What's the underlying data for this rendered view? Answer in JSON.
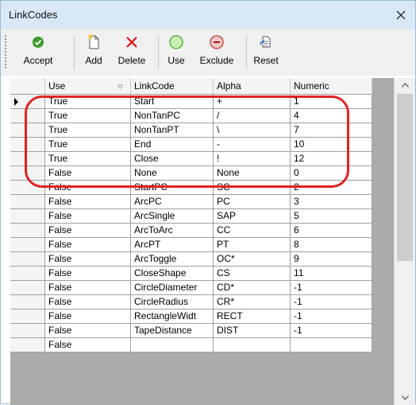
{
  "window": {
    "title": "LinkCodes"
  },
  "toolbar": {
    "buttons": [
      {
        "label": "Accept",
        "icon": "check-circle-icon"
      },
      {
        "label": "Add",
        "icon": "new-document-icon"
      },
      {
        "label": "Delete",
        "icon": "red-x-icon"
      },
      {
        "label": "Use",
        "icon": "green-circle-icon"
      },
      {
        "label": "Exclude",
        "icon": "minus-circle-icon"
      },
      {
        "label": "Reset",
        "icon": "reset-icon"
      }
    ]
  },
  "grid": {
    "columns": [
      "Use",
      "LinkCode",
      "Alpha",
      "Numeric"
    ],
    "current_row": 0,
    "rows": [
      [
        "True",
        "Start",
        "+",
        "1"
      ],
      [
        "True",
        "NonTanPC",
        "/",
        "4"
      ],
      [
        "True",
        "NonTanPT",
        "\\",
        "7"
      ],
      [
        "True",
        "End",
        "-",
        "10"
      ],
      [
        "True",
        "Close",
        "!",
        "12"
      ],
      [
        "False",
        "None",
        "None",
        "0"
      ],
      [
        "False",
        "StartPC",
        "SC",
        "2"
      ],
      [
        "False",
        "ArcPC",
        "PC",
        "3"
      ],
      [
        "False",
        "ArcSingle",
        "SAP",
        "5"
      ],
      [
        "False",
        "ArcToArc",
        "CC",
        "6"
      ],
      [
        "False",
        "ArcPT",
        "PT",
        "8"
      ],
      [
        "False",
        "ArcToggle",
        "OC*",
        "9"
      ],
      [
        "False",
        "CloseShape",
        "CS",
        "11"
      ],
      [
        "False",
        "CircleDiameter",
        "CD*",
        "-1"
      ],
      [
        "False",
        "CircleRadius",
        "CR*",
        "-1"
      ],
      [
        "False",
        "RectangleWidt",
        "RECT",
        "-1"
      ],
      [
        "False",
        "TapeDistance",
        "DIST",
        "-1"
      ],
      [
        "False",
        "",
        "",
        ""
      ]
    ]
  },
  "colors": {
    "titlebar": "#d9e8f7",
    "highlight": "#e02222",
    "grid_background": "#ababab"
  }
}
